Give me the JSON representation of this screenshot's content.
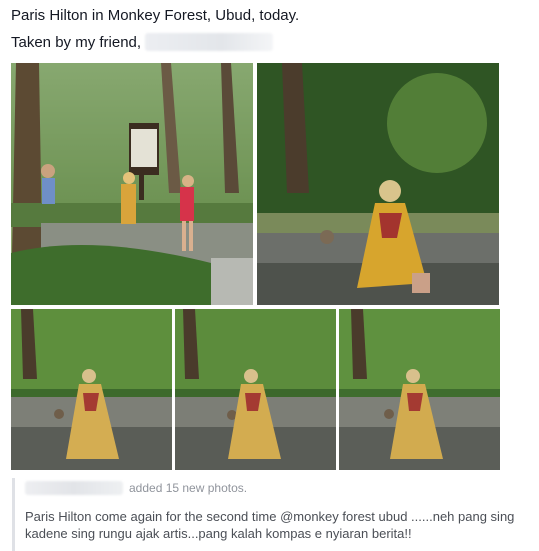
{
  "post": {
    "line1": "Paris Hilton in Monkey Forest, Ubud, today.",
    "line2": "Taken by my friend,"
  },
  "photos": [
    {
      "name": "photo-1",
      "scene": "two women and a man near a sign in the forest"
    },
    {
      "name": "photo-2",
      "scene": "woman sitting on stone wall with a monkey"
    },
    {
      "name": "photo-3",
      "scene": "woman sitting on stone steps with a monkey"
    },
    {
      "name": "photo-4",
      "scene": "woman sitting on stone steps with a monkey"
    },
    {
      "name": "photo-5",
      "scene": "woman sitting on stone steps with a monkey"
    }
  ],
  "attribution": {
    "action": "added 15 new photos.",
    "text": "Paris Hilton come again for the second time @monkey forest ubud ......neh pang sing kadene sing rungu ajak artis...pang kalah kompas e nyiaran berita!!"
  }
}
